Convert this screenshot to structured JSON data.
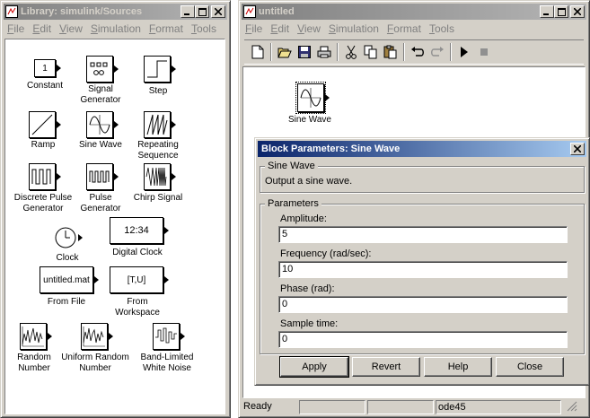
{
  "library": {
    "title": "Library: simulink/Sources",
    "menu": [
      "File",
      "Edit",
      "View",
      "Simulation",
      "Format",
      "Tools"
    ],
    "blocks": {
      "constant": {
        "label": "Constant",
        "box_text": "1"
      },
      "signal_generator": {
        "label": "Signal\nGenerator"
      },
      "step": {
        "label": "Step"
      },
      "ramp": {
        "label": "Ramp"
      },
      "sine_wave": {
        "label": "Sine Wave"
      },
      "repeating_sequence": {
        "label": "Repeating\nSequence"
      },
      "discrete_pulse": {
        "label": "Discrete Pulse\nGenerator"
      },
      "pulse_generator": {
        "label": "Pulse\nGenerator"
      },
      "chirp": {
        "label": "Chirp Signal"
      },
      "clock": {
        "label": "Clock"
      },
      "digital_clock": {
        "label": "Digital Clock",
        "box_text": "12:34"
      },
      "from_file": {
        "label": "From File",
        "box_text": "untitled.mat"
      },
      "from_workspace": {
        "label": "From\nWorkspace",
        "box_text": "[T,U]"
      },
      "random_number": {
        "label": "Random\nNumber"
      },
      "uniform_random": {
        "label": "Uniform Random\nNumber"
      },
      "band_limited": {
        "label": "Band-Limited\nWhite Noise"
      }
    }
  },
  "model": {
    "title": "untitled",
    "menu": [
      "File",
      "Edit",
      "View",
      "Simulation",
      "Format",
      "Tools"
    ],
    "block_label": "Sine Wave",
    "status": {
      "left": "Ready",
      "mid1": "",
      "mid2": "",
      "solver": "ode45"
    }
  },
  "dialog": {
    "title": "Block Parameters: Sine Wave",
    "block_group": "Sine Wave",
    "description": "Output a sine wave.",
    "params_group": "Parameters",
    "fields": [
      {
        "label": "Amplitude:",
        "value": "5"
      },
      {
        "label": "Frequency (rad/sec):",
        "value": "10"
      },
      {
        "label": "Phase (rad):",
        "value": "0"
      },
      {
        "label": "Sample time:",
        "value": "0"
      }
    ],
    "buttons": {
      "apply": "Apply",
      "revert": "Revert",
      "help": "Help",
      "close": "Close"
    }
  }
}
